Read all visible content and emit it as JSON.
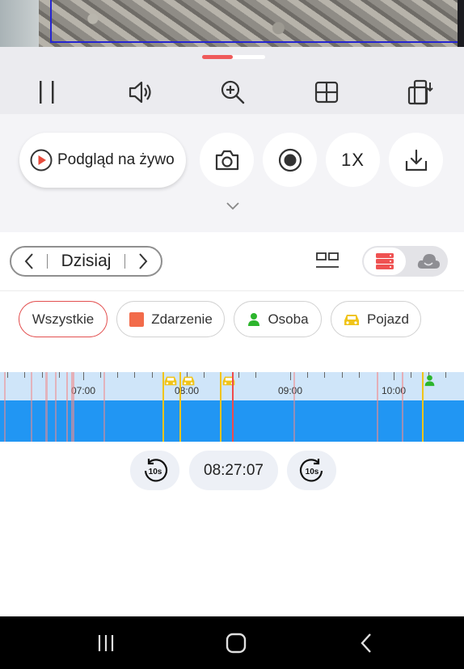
{
  "video": {
    "icon": "camera-feed"
  },
  "controls": {
    "items": [
      {
        "name": "pause-button",
        "icon": "pause-icon"
      },
      {
        "name": "volume-button",
        "icon": "speaker-icon"
      },
      {
        "name": "zoom-button",
        "icon": "zoom-in-icon"
      },
      {
        "name": "layout-button",
        "icon": "grid-icon"
      },
      {
        "name": "rotate-button",
        "icon": "rotate-screen-icon"
      }
    ]
  },
  "actions": {
    "live_label": "Podgląd na żywo",
    "speed_label": "1X"
  },
  "date_nav": {
    "date_label": "Dzisiaj"
  },
  "filters": [
    {
      "label": "Wszystkie",
      "active": true
    },
    {
      "label": "Zdarzenie",
      "color": "#f26b4a"
    },
    {
      "label": "Osoba",
      "color": "#2db52d"
    },
    {
      "label": "Pojazd",
      "color": "#f0c419"
    }
  ],
  "timeline": {
    "hour_labels": [
      "07:00",
      "08:00",
      "09:00",
      "10:00"
    ],
    "colors": {
      "axis": "#cfe5f9",
      "bar": "#2196f3",
      "cursor": "#ef4b4b",
      "event": "#f28a8a",
      "vehicle": "#f0c419",
      "person": "#2db52d"
    }
  },
  "playback": {
    "rewind_label": "10s",
    "current_time": "08:27:07",
    "forward_label": "10s"
  }
}
